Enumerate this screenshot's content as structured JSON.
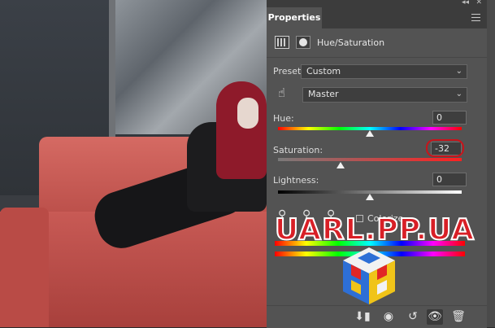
{
  "panel": {
    "tab_label": "Properties",
    "adjustment_title": "Hue/Saturation"
  },
  "preset": {
    "label": "Preset:",
    "value": "Custom"
  },
  "channel": {
    "value": "Master"
  },
  "hue": {
    "label": "Hue:",
    "value": "0",
    "slider_fraction": 0.5
  },
  "saturation": {
    "label": "Saturation:",
    "value": "-32",
    "slider_fraction": 0.34
  },
  "lightness": {
    "label": "Lightness:",
    "value": "0",
    "slider_fraction": 0.5
  },
  "colorize": {
    "label": "Colorize",
    "checked": false
  },
  "watermark": {
    "text": "UARL.PP.UA"
  },
  "colors": {
    "panel_bg": "#535353",
    "tab_bar": "#3c3c3c",
    "highlight_red": "#c8141b"
  }
}
